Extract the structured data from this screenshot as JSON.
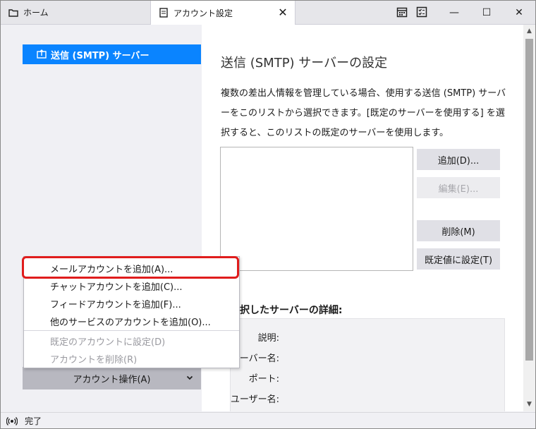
{
  "tabs": {
    "home_label": "ホーム",
    "account_label": "アカウント設定",
    "close_glyph": "✕"
  },
  "toolbar": {
    "calendar_icon": "calendar-icon",
    "tasks_icon": "tasks-icon"
  },
  "window": {
    "minimize": "—",
    "maximize": "☐",
    "close": "✕"
  },
  "sidebar": {
    "selected_item": "送信 (SMTP) サーバー",
    "account_actions": "アカウント操作(A)"
  },
  "main": {
    "title": "送信 (SMTP) サーバーの設定",
    "description": "複数の差出人情報を管理している場合、使用する送信 (SMTP) サーバーをこのリストから選択できます。[既定のサーバーを使用する] を選択すると、このリストの既定のサーバーを使用します。",
    "buttons": {
      "add": "追加(D)...",
      "edit": "編集(E)...",
      "delete": "削除(M)",
      "set_default": "既定値に設定(T)"
    },
    "details_title": "選択したサーバーの詳細:",
    "details_labels": [
      "説明:",
      "サーバー名:",
      "ポート:",
      "ユーザー名:"
    ]
  },
  "menu": {
    "items": [
      {
        "label": "メールアカウントを追加(A)...",
        "enabled": true
      },
      {
        "label": "チャットアカウントを追加(C)...",
        "enabled": true
      },
      {
        "label": "フィードアカウントを追加(F)...",
        "enabled": true
      },
      {
        "label": "他のサービスのアカウントを追加(O)...",
        "enabled": true
      },
      {
        "label": "既定のアカウントに設定(D)",
        "enabled": false
      },
      {
        "label": "アカウントを削除(R)",
        "enabled": false
      }
    ]
  },
  "status": {
    "text": "完了"
  },
  "colors": {
    "accent": "#0a84ff",
    "highlight_border": "#e01c1c"
  }
}
